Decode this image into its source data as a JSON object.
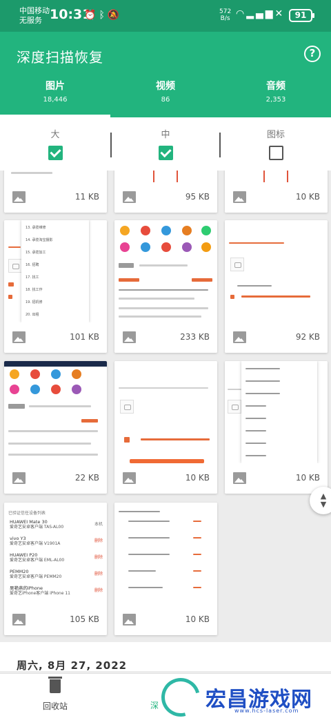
{
  "status_bar": {
    "carrier": "中国移动",
    "service": "无服务",
    "time": "10:31",
    "net_speed_value": "572",
    "net_speed_unit": "B/s",
    "battery": "91"
  },
  "header": {
    "title": "深度扫描恢复",
    "help_icon": "?"
  },
  "tabs": [
    {
      "label": "图片",
      "count": "18,446",
      "active": true
    },
    {
      "label": "视频",
      "count": "86"
    },
    {
      "label": "音频",
      "count": "2,353"
    }
  ],
  "filters": [
    {
      "label": "大",
      "checked": true
    },
    {
      "label": "中",
      "checked": true
    },
    {
      "label": "图标",
      "checked": false
    }
  ],
  "grid": {
    "rows": [
      [
        "11 KB",
        "95 KB",
        "10 KB"
      ],
      [
        "101 KB",
        "233 KB",
        "92 KB"
      ],
      [
        "22 KB",
        "10 KB",
        "10 KB"
      ],
      [
        "105 KB",
        "10 KB"
      ]
    ]
  },
  "thumbnails": {
    "menu_items": [
      "13. 承揽维修",
      "14. 承揽淘宝摄影",
      "15. 承揽加工",
      "16. 招聘",
      "17. 找工",
      "18. 找工作",
      "19. 招机修",
      "20. 出租"
    ],
    "device_list_title": "已验证信任设备列表",
    "devices": [
      {
        "name": "HUAWEI Mate 30",
        "model": "爱奇艺安卓客户端 TAS-AL00",
        "tag": "本机"
      },
      {
        "name": "vivo Y3",
        "model": "爱奇艺安卓客户端 V1901A",
        "tag": "删除"
      },
      {
        "name": "HUAWEI P20",
        "model": "爱奇艺安卓客户端 EML-AL00",
        "tag": "删除"
      },
      {
        "name": "PEMM20",
        "model": "爱奇艺安卓客户端 PEMM20",
        "tag": "删除"
      },
      {
        "name": "吴艳燕的iPhone",
        "model": "爱奇艺iPhone客户端 iPhone 11",
        "tag": "删除"
      }
    ]
  },
  "date_header": "周六, 8月 27, 2022",
  "bottom_nav": {
    "recycle_label": "回收站",
    "scan_label": "深"
  },
  "watermark": {
    "text": "宏昌游戏网",
    "url": "www.hcs-laser.com"
  },
  "colors": {
    "primary": "#22b47e",
    "status_bar": "#1c9a6b",
    "accent_orange": "#f06a34"
  }
}
